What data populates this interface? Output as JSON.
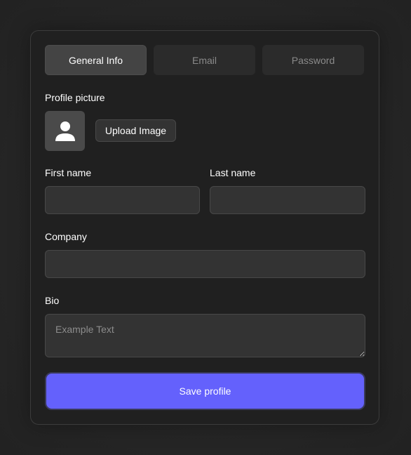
{
  "tabs": [
    {
      "label": "General Info",
      "active": true
    },
    {
      "label": "Email",
      "active": false
    },
    {
      "label": "Password",
      "active": false
    }
  ],
  "profile_picture": {
    "label": "Profile picture",
    "avatar_icon": "user-icon",
    "upload_label": "Upload Image"
  },
  "fields": {
    "first_name": {
      "label": "First name",
      "value": ""
    },
    "last_name": {
      "label": "Last name",
      "value": ""
    },
    "company": {
      "label": "Company",
      "value": ""
    },
    "bio": {
      "label": "Bio",
      "placeholder": "Example Text",
      "value": ""
    }
  },
  "save_label": "Save profile",
  "colors": {
    "accent": "#6461fc",
    "card_background": "#202020",
    "input_background": "#333333"
  }
}
